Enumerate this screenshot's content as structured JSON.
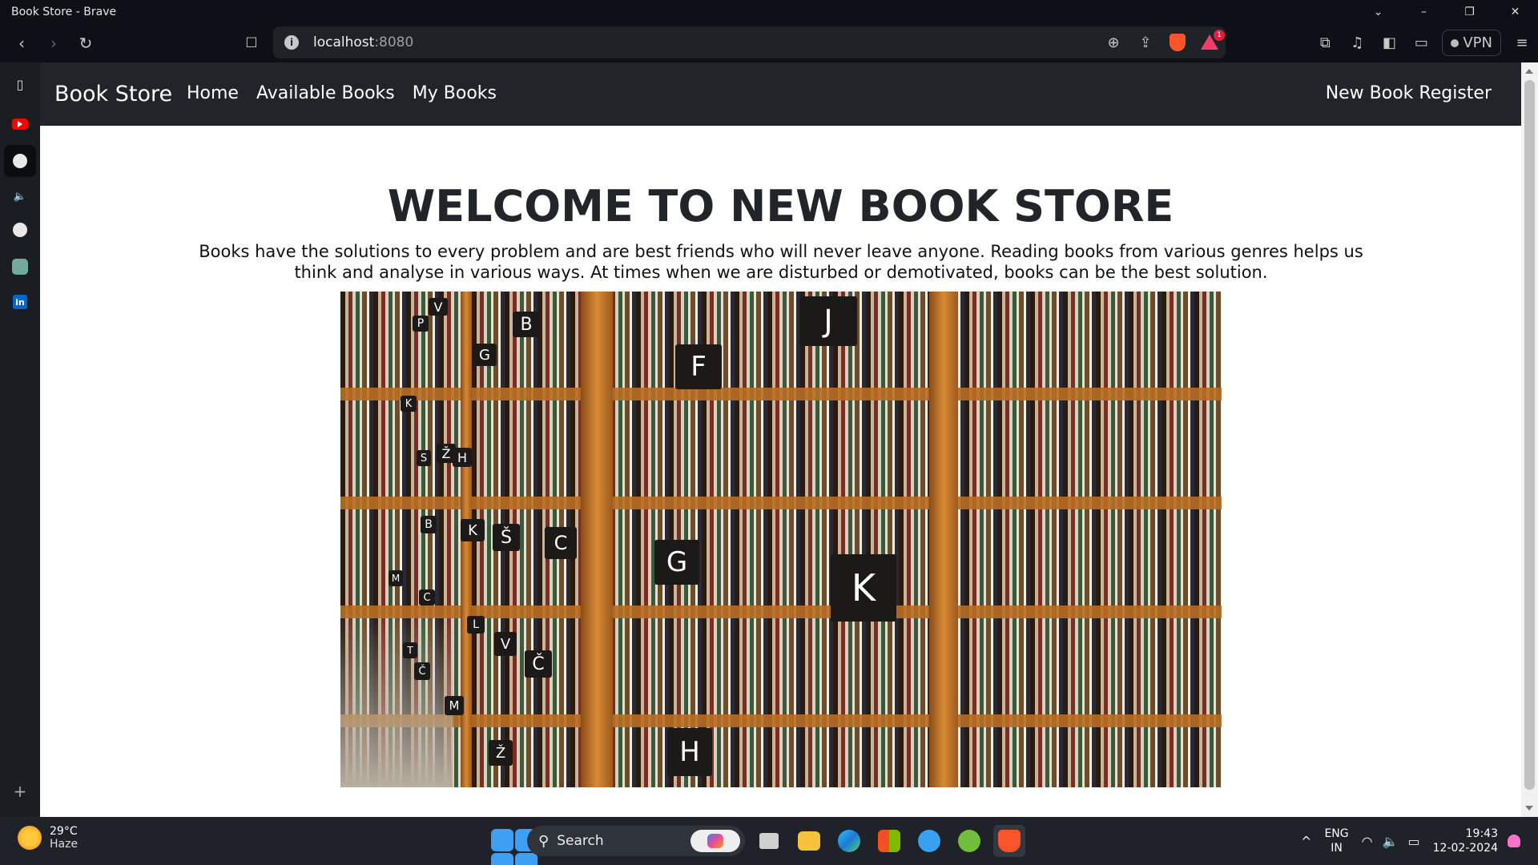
{
  "window": {
    "title": "Book Store - Brave",
    "controls": {
      "minimize": "–",
      "restore": "❐",
      "close": "✕",
      "tabs_dropdown": "⌄"
    }
  },
  "browser": {
    "url_host": "localhost",
    "url_port": ":8080",
    "rewards_badge": "1",
    "vpn_label": "VPN",
    "icons": [
      "back-icon",
      "forward-icon",
      "reload-icon",
      "bookmark-icon",
      "site-info-icon",
      "zoom-icon",
      "share-icon",
      "brave-shields-icon",
      "brave-rewards-icon",
      "extensions-icon",
      "media-icon",
      "sidebar-toggle-icon",
      "wallet-icon",
      "menu-icon"
    ]
  },
  "sidebar": {
    "items": [
      "sidebar-panel-icon",
      "youtube-icon",
      "globe-icon",
      "speaker-icon",
      "github-icon",
      "chatgpt-icon",
      "linkedin-icon"
    ],
    "add_label": "+"
  },
  "navbar": {
    "brand": "Book Store",
    "links": [
      "Home",
      "Available Books",
      "My Books"
    ],
    "register": "New Book Register"
  },
  "main": {
    "heading": "WELCOME TO NEW BOOK STORE",
    "intro": "Books have the solutions to every problem and are best friends who will never leave anyone. Reading books from various genres helps us think and analyse in various ways. At times when we are disturbed or demotivated, books can be the best solution.",
    "hero_tags": [
      "V",
      "P",
      "B",
      "J",
      "G",
      "F",
      "K",
      "Ž",
      "H",
      "S",
      "B",
      "K",
      "Š",
      "C",
      "G",
      "K",
      "M",
      "C",
      "L",
      "V",
      "Č",
      "T",
      "Č",
      "M",
      "Ž",
      "H"
    ]
  },
  "taskbar": {
    "weather_temp": "29°C",
    "weather_desc": "Haze",
    "search_label": "Search",
    "lang_top": "ENG",
    "lang_bottom": "IN",
    "time": "19:43",
    "date": "12-02-2024",
    "tray_chevron": "^"
  }
}
